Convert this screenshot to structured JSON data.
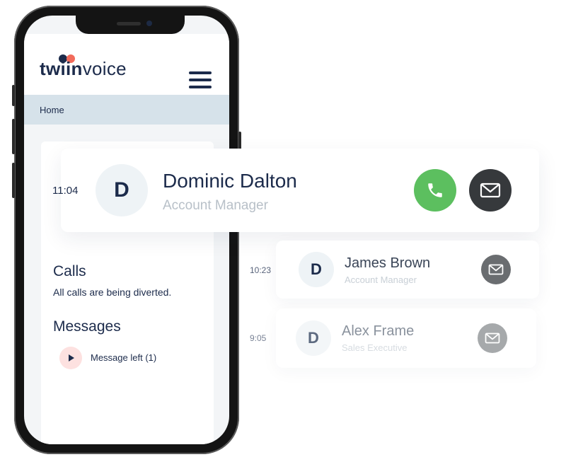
{
  "app": {
    "logo_text_bold": "twiin",
    "logo_text_rest": "voice",
    "breadcrumb": "Home",
    "calls": {
      "title": "Calls",
      "description": "All calls are being diverted."
    },
    "messages": {
      "title": "Messages",
      "item_label": "Message left (1)"
    }
  },
  "contacts": [
    {
      "time": "11:04",
      "initial": "D",
      "name": "Dominic Dalton",
      "role": "Account Manager"
    },
    {
      "time": "10:23",
      "initial": "D",
      "name": "James Brown",
      "role": "Account Manager"
    },
    {
      "time": "9:05",
      "initial": "D",
      "name": "Alex Frame",
      "role": "Sales Executive"
    }
  ],
  "colors": {
    "navy": "#1c2b4b",
    "call_green": "#5cbf5f",
    "logo_coral": "#f26b5b",
    "breadcrumb_bg": "#d6e2ea"
  },
  "icons": [
    "hamburger-icon",
    "play-icon",
    "phone-icon",
    "mail-icon"
  ]
}
